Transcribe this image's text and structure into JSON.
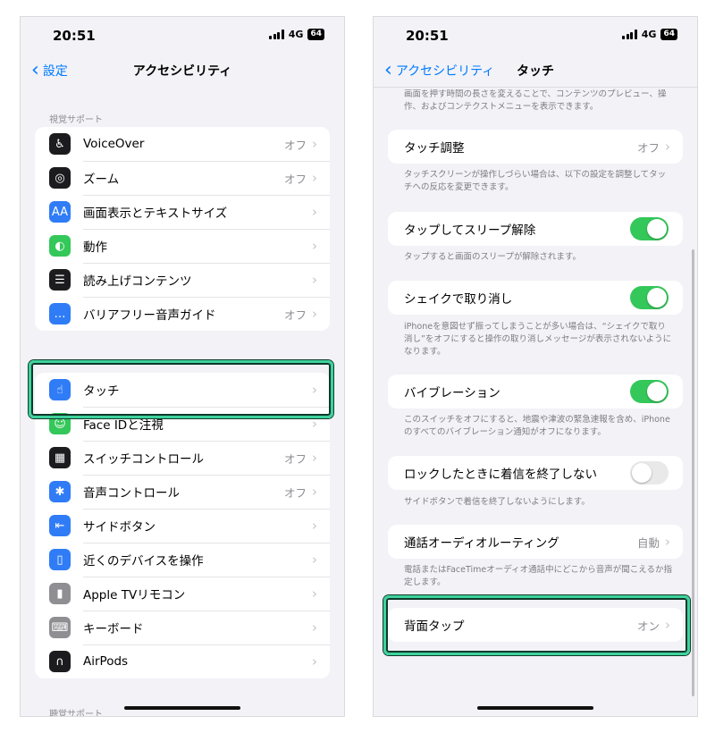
{
  "left": {
    "status": {
      "time": "20:51",
      "network": "4G",
      "battery": "64"
    },
    "nav": {
      "back_label": "設定",
      "title": "アクセシビリティ"
    },
    "section_vision": "視覚サポート",
    "vision_items": [
      {
        "label": "VoiceOver",
        "value": "オフ",
        "icon": "voiceover-icon",
        "color": "#1c1c1e",
        "glyph": "♿"
      },
      {
        "label": "ズーム",
        "value": "オフ",
        "icon": "zoom-icon",
        "color": "#1c1c1e",
        "glyph": "◎"
      },
      {
        "label": "画面表示とテキストサイズ",
        "value": "",
        "icon": "text-size-icon",
        "color": "#2f7cf6",
        "glyph": "AA"
      },
      {
        "label": "動作",
        "value": "",
        "icon": "motion-icon",
        "color": "#34c759",
        "glyph": "◐"
      },
      {
        "label": "読み上げコンテンツ",
        "value": "",
        "icon": "speech-icon",
        "color": "#1c1c1e",
        "glyph": "☰"
      },
      {
        "label": "バリアフリー音声ガイド",
        "value": "オフ",
        "icon": "audio-description-icon",
        "color": "#2f7cf6",
        "glyph": "…"
      }
    ],
    "motor_items": [
      {
        "label": "タッチ",
        "value": "",
        "icon": "touch-icon",
        "color": "#2f7cf6",
        "glyph": "☝"
      },
      {
        "label": "Face IDと注視",
        "value": "",
        "icon": "face-id-icon",
        "color": "#34c759",
        "glyph": "☺"
      },
      {
        "label": "スイッチコントロール",
        "value": "オフ",
        "icon": "switch-control-icon",
        "color": "#1c1c1e",
        "glyph": "▦"
      },
      {
        "label": "音声コントロール",
        "value": "オフ",
        "icon": "voice-control-icon",
        "color": "#2f7cf6",
        "glyph": "✱"
      },
      {
        "label": "サイドボタン",
        "value": "",
        "icon": "side-button-icon",
        "color": "#2f7cf6",
        "glyph": "⇤"
      },
      {
        "label": "近くのデバイスを操作",
        "value": "",
        "icon": "nearby-devices-icon",
        "color": "#2f7cf6",
        "glyph": "▯"
      },
      {
        "label": "Apple TVリモコン",
        "value": "",
        "icon": "remote-icon",
        "color": "#8e8e93",
        "glyph": "▮"
      },
      {
        "label": "キーボード",
        "value": "",
        "icon": "keyboard-icon",
        "color": "#8e8e93",
        "glyph": "⌨"
      },
      {
        "label": "AirPods",
        "value": "",
        "icon": "airpods-icon",
        "color": "#1c1c1e",
        "glyph": "∩"
      }
    ],
    "section_hearing": "聴覚サポート"
  },
  "right": {
    "status": {
      "time": "20:51",
      "network": "4G",
      "battery": "64"
    },
    "nav": {
      "back_label": "アクセシビリティ",
      "title": "タッチ"
    },
    "top_desc": "画面を押す時間の長さを変えることで、コンテンツのプレビュー、操作、およびコンテクストメニューを表示できます。",
    "touch_accommodations": {
      "label": "タッチ調整",
      "value": "オフ"
    },
    "touch_accommodations_desc": "タッチスクリーンが操作しづらい場合は、以下の設定を調整してタッチへの反応を変更できます。",
    "tap_to_wake": {
      "label": "タップしてスリープ解除",
      "on": true
    },
    "tap_to_wake_desc": "タップすると画面のスリープが解除されます。",
    "shake_to_undo": {
      "label": "シェイクで取り消し",
      "on": true
    },
    "shake_to_undo_desc": "iPhoneを意図せず振ってしまうことが多い場合は、“シェイクで取り消し”をオフにすると操作の取り消しメッセージが表示されないようになります。",
    "vibration": {
      "label": "バイブレーション",
      "on": true
    },
    "vibration_desc": "このスイッチをオフにすると、地震や津波の緊急速報を含め、iPhoneのすべてのバイブレーション通知がオフになります。",
    "prevent_lock_end_call": {
      "label": "ロックしたときに着信を終了しない",
      "on": false
    },
    "prevent_lock_end_call_desc": "サイドボタンで着信を終了しないようにします。",
    "call_audio_routing": {
      "label": "通話オーディオルーティング",
      "value": "自動"
    },
    "call_audio_routing_desc": "電話またはFaceTimeオーディオ通話中にどこから音声が聞こえるか指定します。",
    "back_tap": {
      "label": "背面タップ",
      "value": "オン"
    }
  },
  "colors": {
    "accent": "#007aff",
    "toggle_on": "#34c759",
    "highlight": "#3ed29c"
  }
}
